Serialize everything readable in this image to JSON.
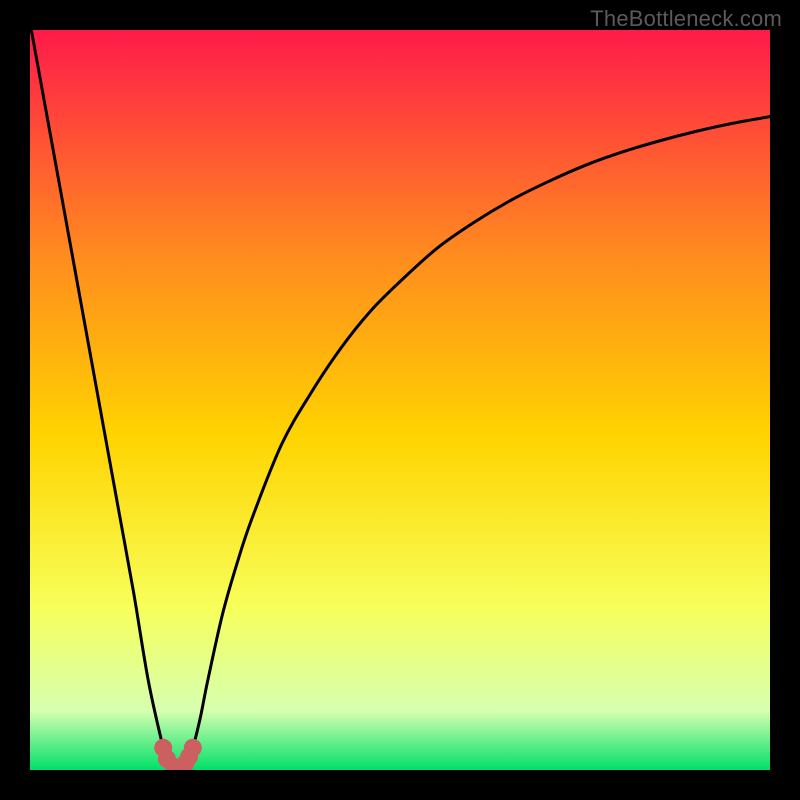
{
  "watermark": "TheBottleneck.com",
  "chart_data": {
    "type": "line",
    "title": "",
    "xlabel": "",
    "ylabel": "",
    "xlim": [
      0,
      100
    ],
    "ylim": [
      0,
      100
    ],
    "x": [
      0,
      2,
      4,
      6,
      8,
      10,
      12,
      14,
      16,
      18,
      18.5,
      19,
      19.5,
      20,
      20.5,
      21,
      21.5,
      22,
      23,
      24,
      26,
      28,
      30,
      34,
      38,
      42,
      46,
      50,
      55,
      60,
      65,
      70,
      75,
      80,
      85,
      90,
      95,
      100
    ],
    "values": [
      101,
      90,
      79,
      68,
      57,
      46,
      35,
      24,
      12,
      3,
      1.5,
      0.8,
      0.4,
      0.3,
      0.4,
      0.9,
      1.8,
      3,
      7,
      12,
      21,
      28,
      34,
      44,
      51,
      57,
      62,
      66,
      70.5,
      74,
      77,
      79.5,
      81.7,
      83.5,
      85,
      86.3,
      87.4,
      88.3
    ],
    "markers": {
      "x": [
        18,
        18.5,
        19.5,
        21,
        21.5,
        22
      ],
      "values": [
        3,
        1.5,
        0.4,
        0.9,
        1.8,
        3
      ]
    },
    "gradient_colors": {
      "top": "#ff1a4a",
      "upper_mid": "#ff8a1f",
      "mid": "#ffd400",
      "lower_mid": "#f7ff5a",
      "near_bottom": "#d6ffb0",
      "bottom": "#00e06a"
    }
  }
}
